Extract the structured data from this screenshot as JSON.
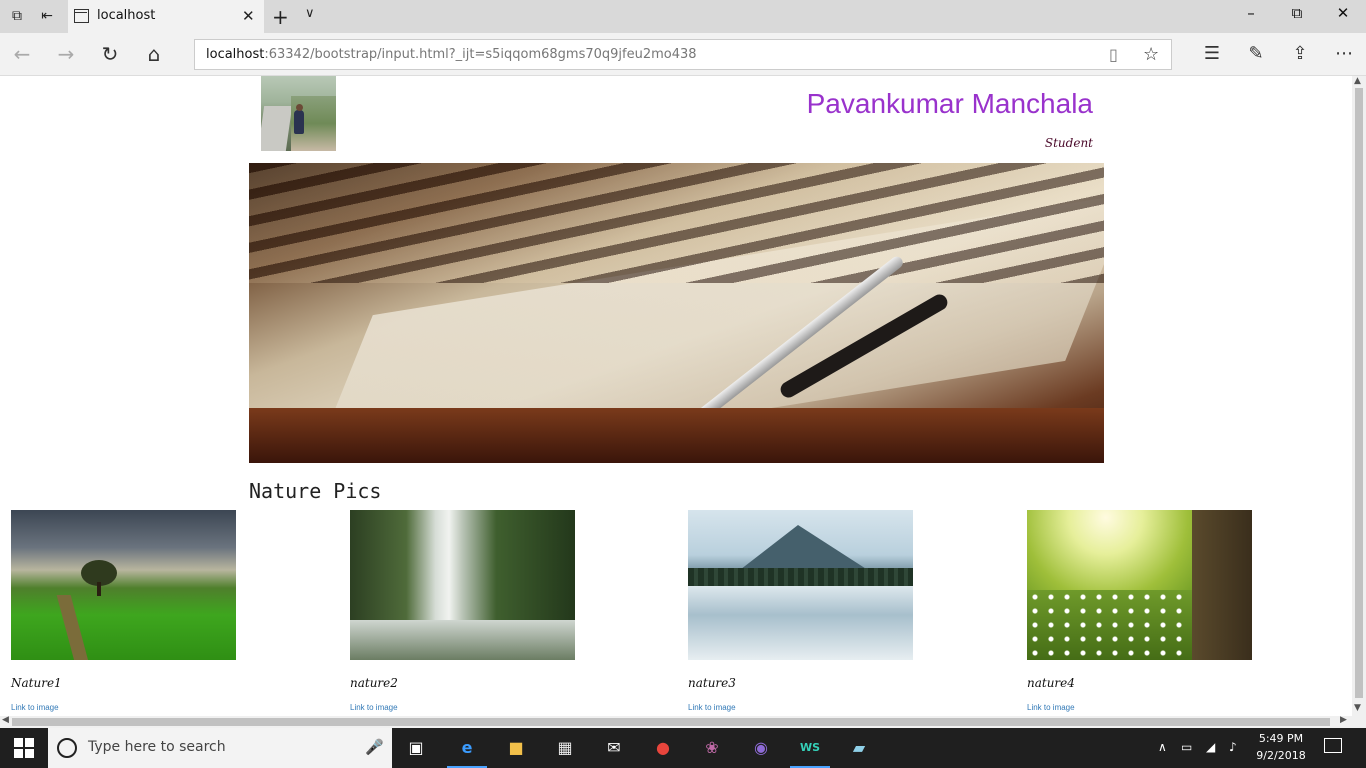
{
  "browser": {
    "tab_title": "localhost",
    "url_host": "localhost",
    "url_path": ":63342/bootstrap/input.html?_ijt=s5iqqom68gms70q9jfeu2mo438"
  },
  "header": {
    "name": "Pavankumar Manchala",
    "role": "Student"
  },
  "nature": {
    "section_title": "Nature Pics",
    "cards": [
      {
        "caption": "Nature1",
        "link": "Link to image"
      },
      {
        "caption": "nature2",
        "link": "Link to image"
      },
      {
        "caption": "nature3",
        "link": "Link to image"
      },
      {
        "caption": "nature4",
        "link": "Link to image"
      }
    ]
  },
  "taskbar": {
    "search_placeholder": "Type here to search",
    "time": "5:49 PM",
    "date": "9/2/2018"
  },
  "colors": {
    "name": "#9932cc",
    "role": "#4b0a2b",
    "link": "#337ab7"
  }
}
